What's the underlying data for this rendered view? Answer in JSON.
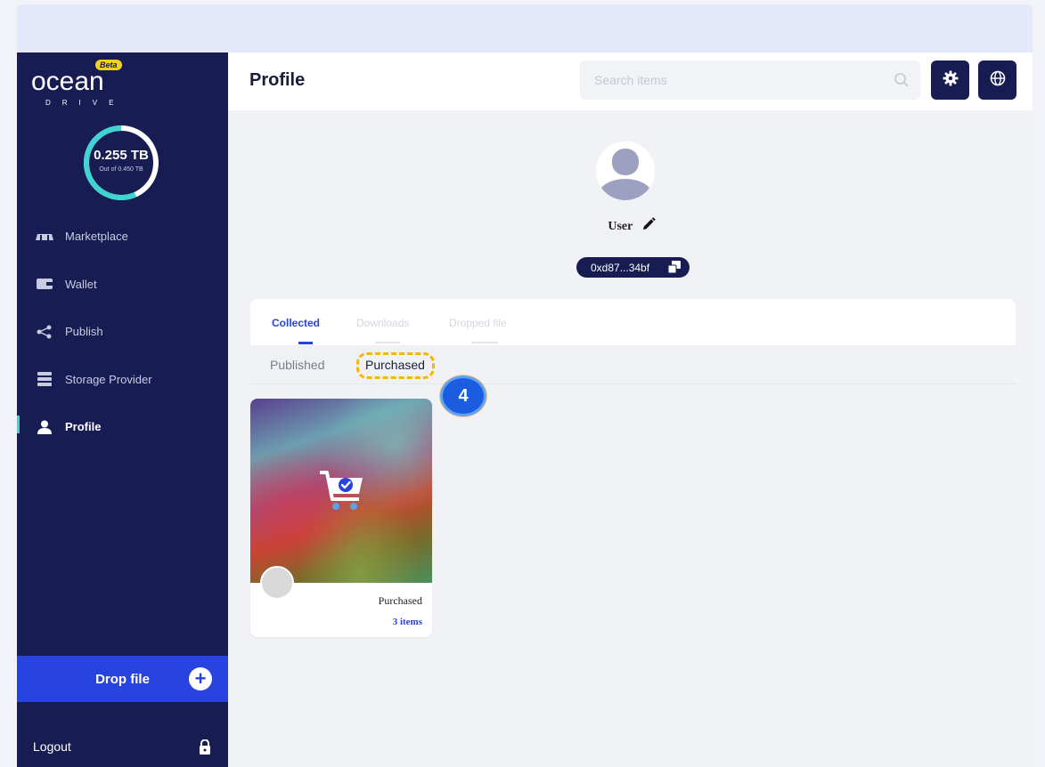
{
  "brand": {
    "name": "ocean",
    "sub": "DRIVE",
    "beta": "Beta"
  },
  "storage": {
    "used": "0.255 TB",
    "total": "Out of 0.450 TB",
    "fraction": 0.567
  },
  "sidebar": {
    "items": [
      {
        "label": "Marketplace",
        "icon": "marketplace-icon"
      },
      {
        "label": "Wallet",
        "icon": "wallet-icon"
      },
      {
        "label": "Publish",
        "icon": "share-icon"
      },
      {
        "label": "Storage Provider",
        "icon": "server-icon"
      },
      {
        "label": "Profile",
        "icon": "user-icon",
        "active": true
      }
    ],
    "drop_file": "Drop file",
    "logout": "Logout"
  },
  "header": {
    "title": "Profile",
    "search_placeholder": "Search items"
  },
  "profile": {
    "username": "User",
    "address": "0xd87...34bf"
  },
  "tabs": [
    {
      "label": "Collected",
      "active": true
    },
    {
      "label": "Downloads",
      "active": false
    },
    {
      "label": "Dropped file",
      "active": false
    }
  ],
  "subtabs": [
    {
      "label": "Published",
      "active": false
    },
    {
      "label": "Purchased",
      "active": true
    }
  ],
  "step_marker": "4",
  "cards": [
    {
      "title": "Purchased",
      "count": "3 items"
    }
  ],
  "colors": {
    "sidebar": "#171c52",
    "accent": "#2743e0",
    "teal": "#3fd4d1",
    "highlight": "#f6b500"
  }
}
